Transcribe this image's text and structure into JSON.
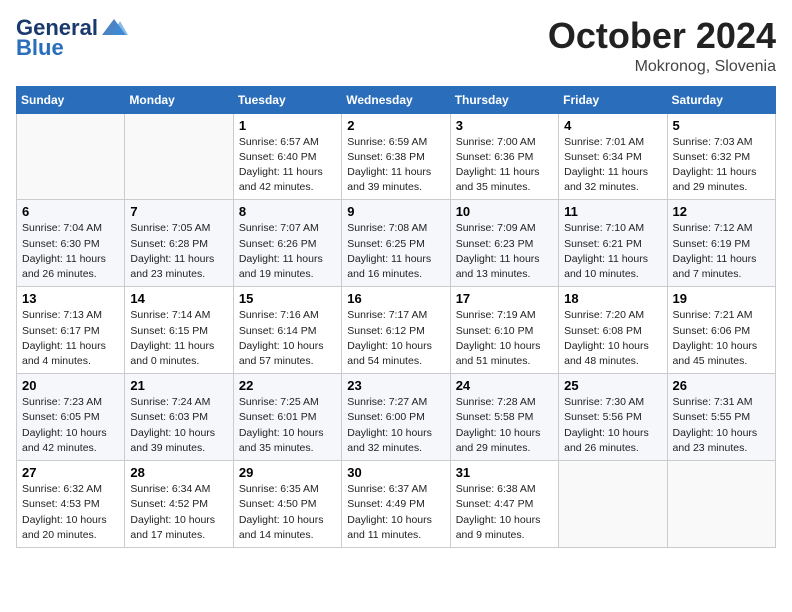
{
  "header": {
    "logo_general": "General",
    "logo_blue": "Blue",
    "month_title": "October 2024",
    "location": "Mokronog, Slovenia"
  },
  "days_of_week": [
    "Sunday",
    "Monday",
    "Tuesday",
    "Wednesday",
    "Thursday",
    "Friday",
    "Saturday"
  ],
  "weeks": [
    [
      {
        "day": "",
        "info": ""
      },
      {
        "day": "",
        "info": ""
      },
      {
        "day": "1",
        "info": "Sunrise: 6:57 AM\nSunset: 6:40 PM\nDaylight: 11 hours and 42 minutes."
      },
      {
        "day": "2",
        "info": "Sunrise: 6:59 AM\nSunset: 6:38 PM\nDaylight: 11 hours and 39 minutes."
      },
      {
        "day": "3",
        "info": "Sunrise: 7:00 AM\nSunset: 6:36 PM\nDaylight: 11 hours and 35 minutes."
      },
      {
        "day": "4",
        "info": "Sunrise: 7:01 AM\nSunset: 6:34 PM\nDaylight: 11 hours and 32 minutes."
      },
      {
        "day": "5",
        "info": "Sunrise: 7:03 AM\nSunset: 6:32 PM\nDaylight: 11 hours and 29 minutes."
      }
    ],
    [
      {
        "day": "6",
        "info": "Sunrise: 7:04 AM\nSunset: 6:30 PM\nDaylight: 11 hours and 26 minutes."
      },
      {
        "day": "7",
        "info": "Sunrise: 7:05 AM\nSunset: 6:28 PM\nDaylight: 11 hours and 23 minutes."
      },
      {
        "day": "8",
        "info": "Sunrise: 7:07 AM\nSunset: 6:26 PM\nDaylight: 11 hours and 19 minutes."
      },
      {
        "day": "9",
        "info": "Sunrise: 7:08 AM\nSunset: 6:25 PM\nDaylight: 11 hours and 16 minutes."
      },
      {
        "day": "10",
        "info": "Sunrise: 7:09 AM\nSunset: 6:23 PM\nDaylight: 11 hours and 13 minutes."
      },
      {
        "day": "11",
        "info": "Sunrise: 7:10 AM\nSunset: 6:21 PM\nDaylight: 11 hours and 10 minutes."
      },
      {
        "day": "12",
        "info": "Sunrise: 7:12 AM\nSunset: 6:19 PM\nDaylight: 11 hours and 7 minutes."
      }
    ],
    [
      {
        "day": "13",
        "info": "Sunrise: 7:13 AM\nSunset: 6:17 PM\nDaylight: 11 hours and 4 minutes."
      },
      {
        "day": "14",
        "info": "Sunrise: 7:14 AM\nSunset: 6:15 PM\nDaylight: 11 hours and 0 minutes."
      },
      {
        "day": "15",
        "info": "Sunrise: 7:16 AM\nSunset: 6:14 PM\nDaylight: 10 hours and 57 minutes."
      },
      {
        "day": "16",
        "info": "Sunrise: 7:17 AM\nSunset: 6:12 PM\nDaylight: 10 hours and 54 minutes."
      },
      {
        "day": "17",
        "info": "Sunrise: 7:19 AM\nSunset: 6:10 PM\nDaylight: 10 hours and 51 minutes."
      },
      {
        "day": "18",
        "info": "Sunrise: 7:20 AM\nSunset: 6:08 PM\nDaylight: 10 hours and 48 minutes."
      },
      {
        "day": "19",
        "info": "Sunrise: 7:21 AM\nSunset: 6:06 PM\nDaylight: 10 hours and 45 minutes."
      }
    ],
    [
      {
        "day": "20",
        "info": "Sunrise: 7:23 AM\nSunset: 6:05 PM\nDaylight: 10 hours and 42 minutes."
      },
      {
        "day": "21",
        "info": "Sunrise: 7:24 AM\nSunset: 6:03 PM\nDaylight: 10 hours and 39 minutes."
      },
      {
        "day": "22",
        "info": "Sunrise: 7:25 AM\nSunset: 6:01 PM\nDaylight: 10 hours and 35 minutes."
      },
      {
        "day": "23",
        "info": "Sunrise: 7:27 AM\nSunset: 6:00 PM\nDaylight: 10 hours and 32 minutes."
      },
      {
        "day": "24",
        "info": "Sunrise: 7:28 AM\nSunset: 5:58 PM\nDaylight: 10 hours and 29 minutes."
      },
      {
        "day": "25",
        "info": "Sunrise: 7:30 AM\nSunset: 5:56 PM\nDaylight: 10 hours and 26 minutes."
      },
      {
        "day": "26",
        "info": "Sunrise: 7:31 AM\nSunset: 5:55 PM\nDaylight: 10 hours and 23 minutes."
      }
    ],
    [
      {
        "day": "27",
        "info": "Sunrise: 6:32 AM\nSunset: 4:53 PM\nDaylight: 10 hours and 20 minutes."
      },
      {
        "day": "28",
        "info": "Sunrise: 6:34 AM\nSunset: 4:52 PM\nDaylight: 10 hours and 17 minutes."
      },
      {
        "day": "29",
        "info": "Sunrise: 6:35 AM\nSunset: 4:50 PM\nDaylight: 10 hours and 14 minutes."
      },
      {
        "day": "30",
        "info": "Sunrise: 6:37 AM\nSunset: 4:49 PM\nDaylight: 10 hours and 11 minutes."
      },
      {
        "day": "31",
        "info": "Sunrise: 6:38 AM\nSunset: 4:47 PM\nDaylight: 10 hours and 9 minutes."
      },
      {
        "day": "",
        "info": ""
      },
      {
        "day": "",
        "info": ""
      }
    ]
  ]
}
